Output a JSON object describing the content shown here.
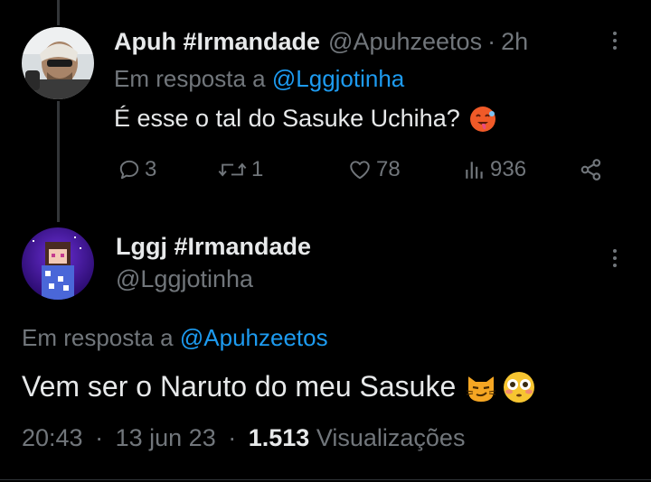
{
  "reply_tweet": {
    "author_name": "Apuh #Irmandade",
    "author_handle": "@Apuhzeetos",
    "separator": "·",
    "time": "2h",
    "replying_prefix": "Em resposta a",
    "replying_to": "@Lggjotinha",
    "text": "É esse o tal do Sasuke Uchiha?",
    "emoji": "hot-face-emoji",
    "actions": {
      "replies": "3",
      "retweets": "1",
      "likes": "78",
      "views": "936"
    }
  },
  "main_tweet": {
    "author_name": "Lggj #Irmandade",
    "author_handle": "@Lggjotinha",
    "replying_prefix": "Em resposta a",
    "replying_to": "@Apuhzeetos",
    "text": "Vem ser o Naruto do meu Sasuke",
    "emojis": [
      "smirking-cat-emoji",
      "flushed-face-emoji"
    ],
    "time": "20:43",
    "separator": "·",
    "date": "13 jun 23",
    "views_count": "1.513",
    "views_label": "Visualizações"
  },
  "colors": {
    "background": "#000000",
    "text": "#e7e9ea",
    "muted": "#71767b",
    "link": "#1d9bf0"
  }
}
